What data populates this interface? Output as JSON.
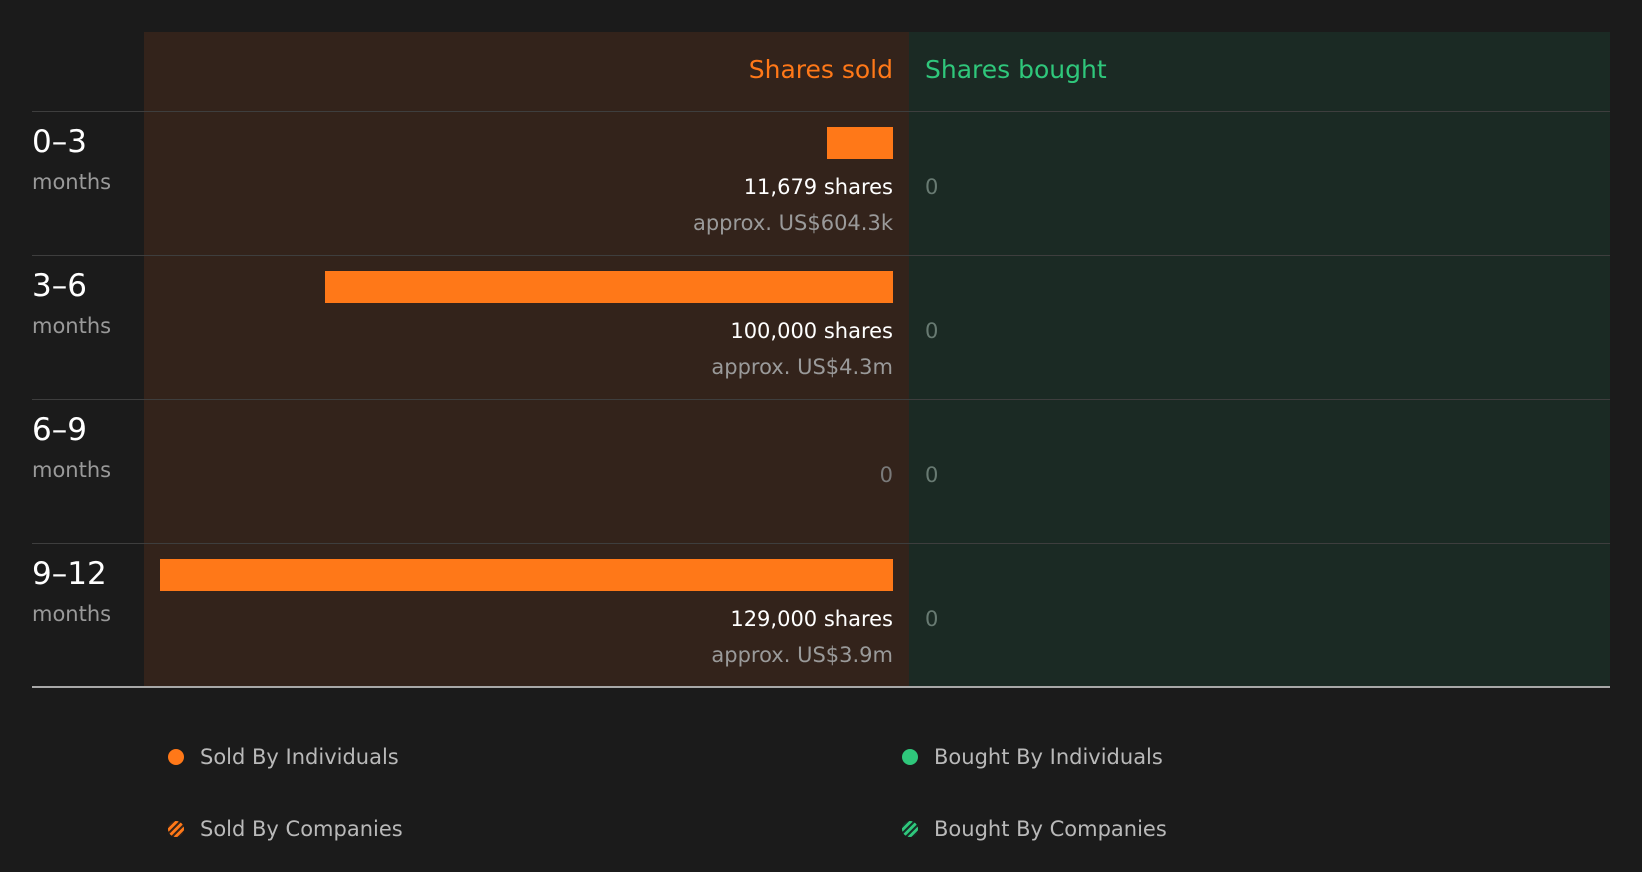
{
  "chart_data": {
    "type": "bar",
    "headers": {
      "sold": "Shares sold",
      "bought": "Shares bought"
    },
    "max_shares": 129000,
    "rows": [
      {
        "period": "0–3",
        "unit": "months",
        "sold_shares": 11679,
        "sold_label": "11,679 shares",
        "sold_approx": "approx. US$604.3k",
        "bought_label": "0"
      },
      {
        "period": "3–6",
        "unit": "months",
        "sold_shares": 100000,
        "sold_label": "100,000 shares",
        "sold_approx": "approx. US$4.3m",
        "bought_label": "0"
      },
      {
        "period": "6–9",
        "unit": "months",
        "sold_shares": 0,
        "sold_label": "0",
        "sold_approx": "",
        "bought_label": "0"
      },
      {
        "period": "9–12",
        "unit": "months",
        "sold_shares": 129000,
        "sold_label": "129,000 shares",
        "sold_approx": "approx. US$3.9m",
        "bought_label": "0"
      }
    ],
    "legend": [
      {
        "label": "Sold By Individuals",
        "style": "solid",
        "color": "#ff7818"
      },
      {
        "label": "Bought By Individuals",
        "style": "solid",
        "color": "#2fc77b"
      },
      {
        "label": "Sold By Companies",
        "style": "hatched",
        "color": "#ff7818"
      },
      {
        "label": "Bought By Companies",
        "style": "hatched",
        "color": "#2fc77b"
      }
    ],
    "colors": {
      "sold": "#ff7818",
      "bought": "#2fc77b",
      "background": "#1b1b1b"
    }
  }
}
